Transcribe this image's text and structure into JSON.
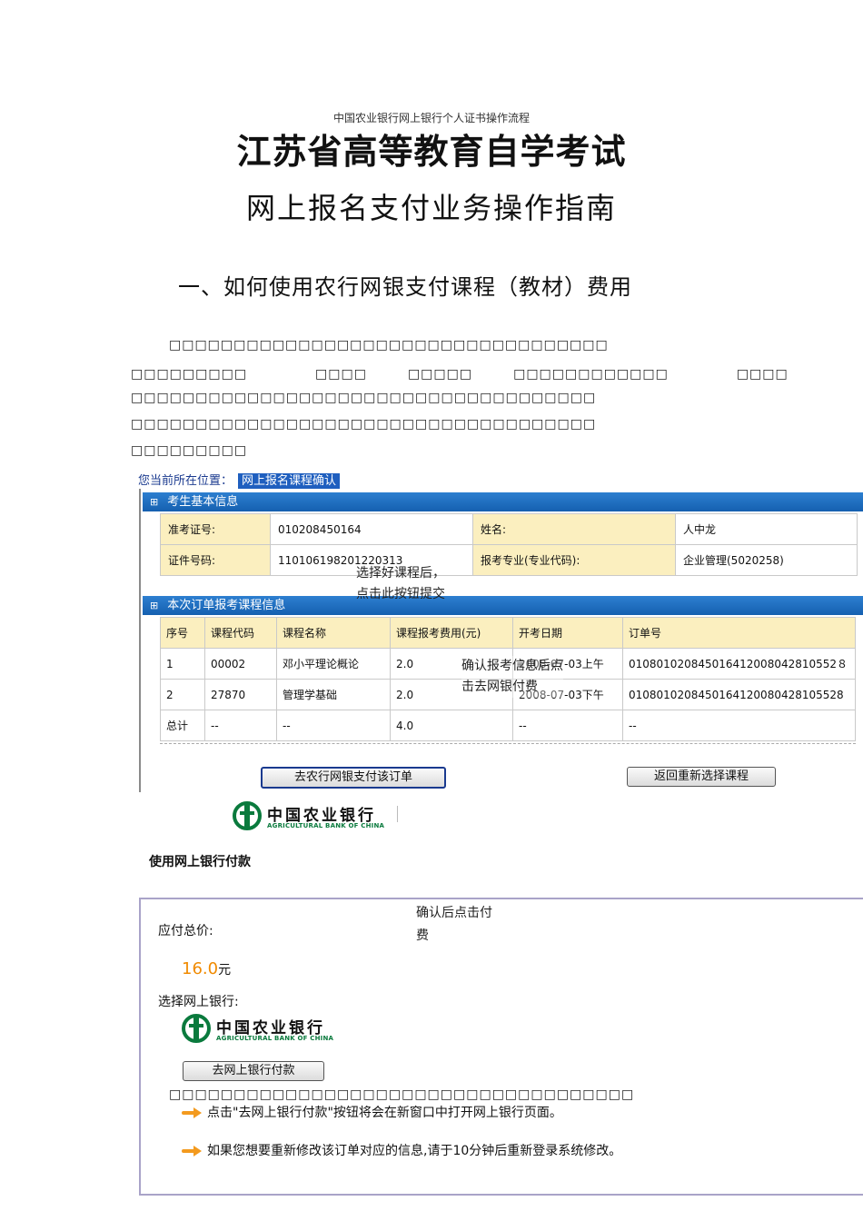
{
  "header_note": "中国农业银行网上银行个人证书操作流程",
  "title": "江苏省高等教育自学考试",
  "subtitle": "网上报名支付业务操作指南",
  "section_heading": "一、如何使用农行网银支付课程（教材）费用",
  "paragraph_lines": [
    "　　　　　　　　　　　　　　　　　　　　　　　　　　　　　",
    "　　　　　　　　　　　　　　　　　　　　　　　　　　　　　　　　",
    "　　　　　　　　　　　　　　　　　　　　　　　　　　　　　　",
    "　　　　　　　　　　　　　　　　　　　　　　　　　　　　　　",
    "　　　　　　　　"
  ],
  "screen1": {
    "location_label": "您当前所在位置：",
    "location_current": "网上报名课程确认",
    "basic_info_header": "考生基本信息",
    "info_rows": [
      {
        "label1": "准考证号:",
        "value1": "010208450164",
        "label2": "姓名:",
        "value2": "人中龙"
      },
      {
        "label1": "证件号码:",
        "value1": "110106198201220313",
        "label2": "报考专业(专业代码):",
        "value2": "企业管理(5020258)"
      }
    ],
    "order_header": "本次订单报考课程信息",
    "columns": [
      "序号",
      "课程代码",
      "课程名称",
      "课程报考费用(元)",
      "开考日期",
      "订单号"
    ],
    "rows": [
      [
        "1",
        "00002",
        "邓小平理论概论",
        "2.0",
        "2008-07-03上午",
        "010801020845016412008042810552８"
      ],
      [
        "2",
        "27870",
        "管理学基础",
        "2.0",
        "2008-07-03下午",
        "0108010208450164120080428105528"
      ],
      [
        "总计",
        "--",
        "--",
        "4.0",
        "--",
        "--"
      ]
    ],
    "pay_button": "去农行网银支付该订单",
    "back_button": "返回重新选择课程",
    "annotation_submit": [
      "选择好课程后，",
      "点击此按钮提交"
    ],
    "annotation_confirm": [
      "确认报考信息后点",
      "击去网银付费"
    ]
  },
  "bank": {
    "name_cn": "中国农业银行",
    "name_en": "AGRICULTURAL BANK OF CHINA"
  },
  "screen2": {
    "heading": "使用网上银行付款",
    "total_label": "应付总价:",
    "amount": "16.0",
    "currency": "元",
    "choose_bank_label": "选择网上银行:",
    "pay_button": "去网上银行付款",
    "annotation": [
      "确认后点击付",
      "费"
    ],
    "notes": [
      "点击\"去网上银行付款\"按钮将会在新窗口中打开网上银行页面。",
      "如果您想要重新修改该订单对应的信息,请于10分钟后重新登录系统修改。"
    ]
  },
  "colors": {
    "section_header_blue": "#1560b0",
    "label_background": "#fbefbf",
    "abc_green": "#0a7a3d",
    "amount_orange": "#f08a00",
    "arrow_orange": "#f39a1e"
  }
}
